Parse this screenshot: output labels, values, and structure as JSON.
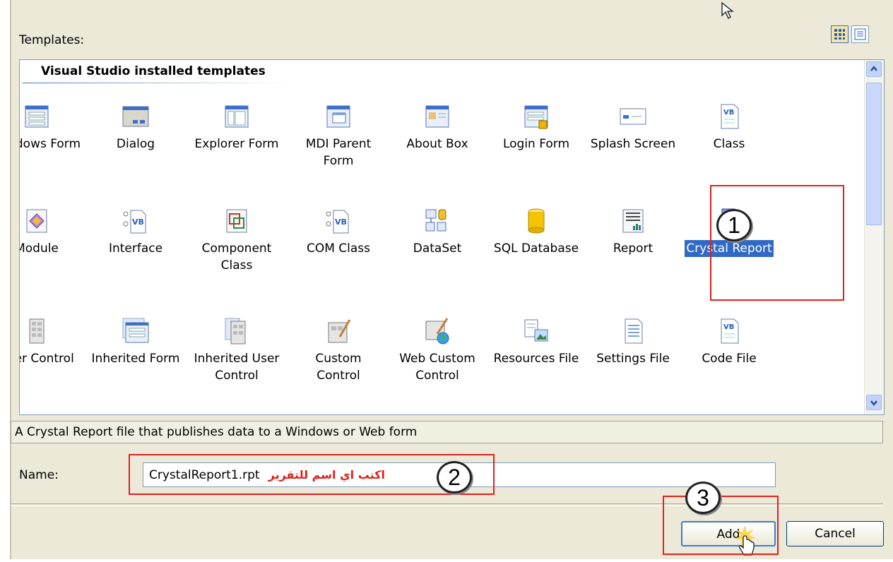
{
  "dialog": {
    "templates_label": "Templates:",
    "group_title": "Visual Studio installed templates",
    "view_buttons": [
      {
        "icon": "large-icons-view-icon",
        "active": true
      },
      {
        "icon": "list-view-icon",
        "active": false
      }
    ],
    "templates": [
      {
        "label": "Windows Form",
        "icon": "windows-form-icon"
      },
      {
        "label": "Dialog",
        "icon": "dialog-icon"
      },
      {
        "label": "Explorer Form",
        "icon": "explorer-form-icon"
      },
      {
        "label": "MDI Parent\nForm",
        "icon": "mdi-parent-form-icon"
      },
      {
        "label": "About Box",
        "icon": "about-box-icon"
      },
      {
        "label": "Login Form",
        "icon": "login-form-icon"
      },
      {
        "label": "Splash Screen",
        "icon": "splash-screen-icon"
      },
      {
        "label": "Class",
        "icon": "vb-class-icon"
      },
      {
        "label": "Module",
        "icon": "module-icon"
      },
      {
        "label": "Interface",
        "icon": "interface-icon"
      },
      {
        "label": "Component\nClass",
        "icon": "component-class-icon"
      },
      {
        "label": "COM Class",
        "icon": "com-class-icon"
      },
      {
        "label": "DataSet",
        "icon": "dataset-icon"
      },
      {
        "label": "SQL Database",
        "icon": "sql-database-icon"
      },
      {
        "label": "Report",
        "icon": "report-icon"
      },
      {
        "label": "Crystal Report",
        "icon": "crystal-report-icon",
        "selected": true
      },
      {
        "label": "User Control",
        "icon": "user-control-icon"
      },
      {
        "label": "Inherited Form",
        "icon": "inherited-form-icon"
      },
      {
        "label": "Inherited User\nControl",
        "icon": "inherited-user-control-icon"
      },
      {
        "label": "Custom\nControl",
        "icon": "custom-control-icon"
      },
      {
        "label": "Web Custom\nControl",
        "icon": "web-custom-control-icon"
      },
      {
        "label": "Resources File",
        "icon": "resources-file-icon"
      },
      {
        "label": "Settings File",
        "icon": "settings-file-icon"
      },
      {
        "label": "Code File",
        "icon": "vb-code-file-icon"
      }
    ],
    "description": "A Crystal Report file that publishes data to a Windows or Web form",
    "name_label": "Name:",
    "name_value": "CrystalReport1.rpt",
    "name_annotation": "اكتب اي اسم للتقرير",
    "add_label": "Add",
    "cancel_label": "Cancel"
  },
  "annotations": {
    "step1": "1",
    "step2": "2",
    "step3": "3",
    "highlight_color": "#e02020"
  },
  "colors": {
    "dialog_bg": "#ece9d8",
    "selection": "#316ac5",
    "border": "#7f9db9"
  }
}
